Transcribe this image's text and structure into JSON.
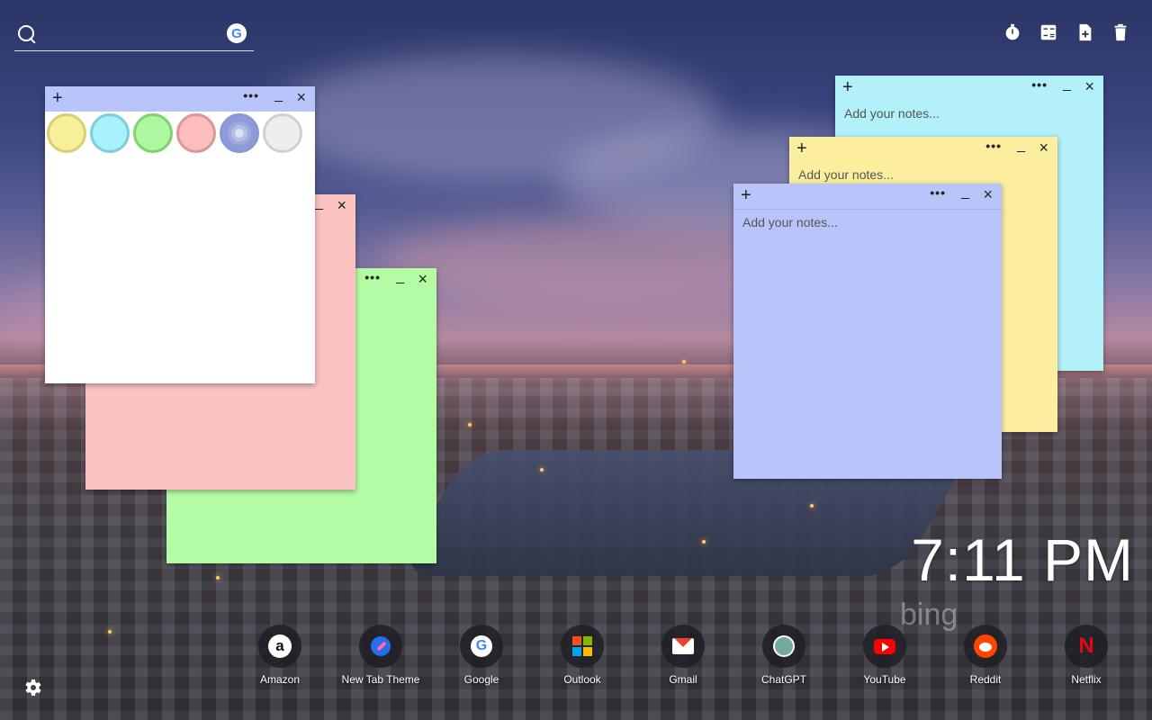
{
  "search": {
    "placeholder": "",
    "value": ""
  },
  "tools": [
    {
      "name": "timer-icon"
    },
    {
      "name": "calculator-icon"
    },
    {
      "name": "add-note-icon"
    },
    {
      "name": "trash-icon"
    }
  ],
  "notes": {
    "plus_label": "+",
    "more_label": "•••",
    "minimize_label": "_",
    "close_label": "×",
    "placeholder": "Add your notes..."
  },
  "palette": {
    "colors": [
      "#f8ef9a",
      "#a8f0fa",
      "#adf7a0",
      "#fbbdbd",
      "#a7b0e8",
      "#eeeeee"
    ],
    "selected_index": 4
  },
  "note_colors": {
    "white": "#ffffff",
    "pink": "#fbc2c2",
    "green": "#b4fca4",
    "blue": "#b9c4fb",
    "yellow": "#fbef9f",
    "cyan": "#b2f0fa"
  },
  "clock": {
    "time": "7:11 PM"
  },
  "background": {
    "brand": "bing"
  },
  "shortcuts": [
    {
      "label": "Amazon"
    },
    {
      "label": "New Tab Theme"
    },
    {
      "label": "Google"
    },
    {
      "label": "Outlook"
    },
    {
      "label": "Gmail"
    },
    {
      "label": "ChatGPT"
    },
    {
      "label": "YouTube"
    },
    {
      "label": "Reddit"
    },
    {
      "label": "Netflix"
    }
  ]
}
